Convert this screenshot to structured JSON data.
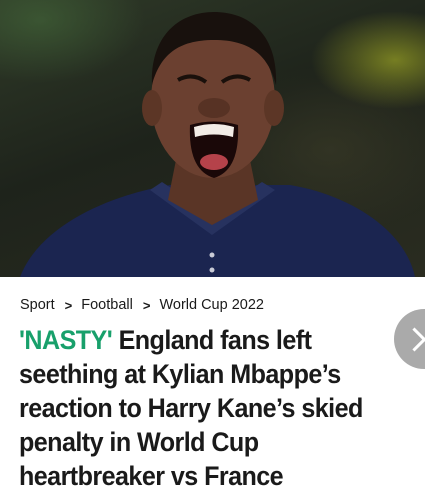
{
  "hero": {
    "image_label": "Kylian Mbappe laughing in a navy France shirt"
  },
  "breadcrumb": {
    "items": [
      "Sport",
      "Football",
      "World Cup 2022"
    ],
    "separator": ">"
  },
  "article": {
    "kicker": "'NASTY'",
    "headline": " England fans left seething at Kylian Mbappe’s reaction to Harry Kane’s skied penalty in World Cup heartbreaker vs France"
  },
  "colors": {
    "kicker": "#18a06b",
    "text": "#1a1a1a",
    "next_button": "#9c9c9c"
  },
  "icons": {
    "next": "chevron-right-icon",
    "breadcrumb_separator": "chevron-right-icon"
  }
}
